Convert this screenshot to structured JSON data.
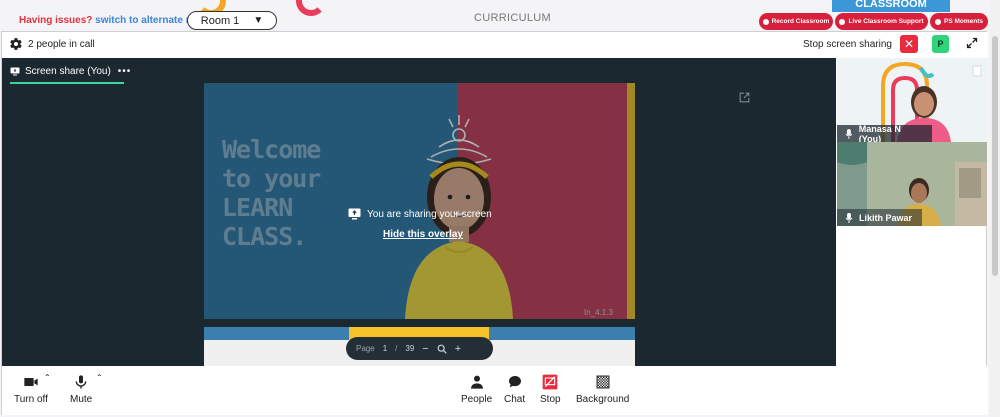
{
  "topbar": {
    "issues_prefix": "Having issues?",
    "issues_link": "switch to alternate room",
    "room_label": "Room 1",
    "room_arrow": "▼",
    "curriculum": "CURRICULUM",
    "classroom_tab": "CLASSROOM",
    "record_label": "Record Classroom",
    "support_label": "Live Classroom Support",
    "ps_label": "PS Moments"
  },
  "callbar": {
    "people_count": "2 people in call",
    "stop_share": "Stop screen sharing",
    "close_glyph": "✕",
    "avatar_letter": "P"
  },
  "stage": {
    "tab_label": "Screen share (You)",
    "tab_more": "•••",
    "welcome_lines": [
      "Welcome",
      "to your",
      "LEARN",
      "CLASS."
    ],
    "slide_code": "In_4.1.3",
    "sharing_message": "You are sharing your screen",
    "hide_overlay": "Hide this overlay",
    "pager": {
      "page_label": "Page",
      "page_current": "1",
      "page_sep": "/",
      "page_total": "39",
      "zoom_out": "−",
      "zoom_in": "+"
    }
  },
  "participants": [
    {
      "name": "Manasa N (You)"
    },
    {
      "name": "Likith Pawar"
    }
  ],
  "controls": {
    "camera": "Turn off",
    "mute": "Mute",
    "people": "People",
    "chat": "Chat",
    "stop": "Stop",
    "background": "Background",
    "caret": "⌃"
  },
  "colors": {
    "accent_red": "#d81f3c",
    "link_blue": "#3b84d8",
    "tab_underline": "#3ed6a0",
    "avatar_green": "#2ed47a"
  }
}
